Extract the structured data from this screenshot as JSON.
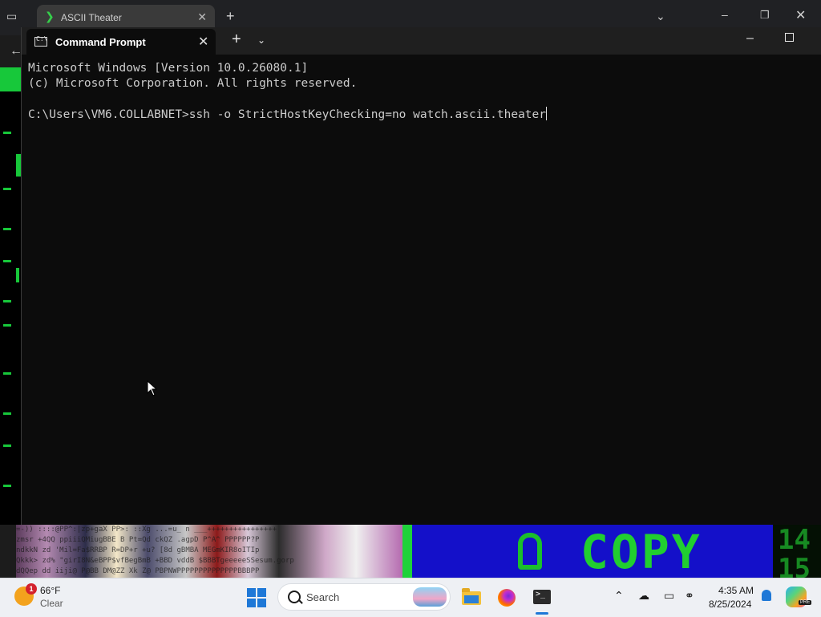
{
  "background_window": {
    "tab_title": "ASCII Theater",
    "ascii_rows": [
      "=-)) ::::@PP^:|zp+gaX  PP>:  ::Xg  ...=u_  n  ___++++++++++++++++",
      "zmsr +4QQ  ppiiiQMiugBBE    B  Pt=Qd    ckQZ  .agpD  P^A^  PPPPPP?P",
      "ndkkN zd   'Mil=Fa$RRBP   R=DP+r +u?  [8d  gBMBA  MEGmKIR8oITIp",
      "Qkkk> zd%   \"girI8N&eBPP$vfBegBmB +BBD  vddB  $BBBTgeeeeeSSesum.gorp",
      "dQQep dd     iiji@   P@BB  DM@ZZ  Xk  Z@  PBPNWPPPPPPPPPPPPPPBBBPP"
    ],
    "copy_banner_text": "COPY",
    "right_numbers": [
      "14",
      "15"
    ]
  },
  "terminal": {
    "tab_title": "Command Prompt",
    "lines": [
      "Microsoft Windows [Version 10.0.26080.1]",
      "(c) Microsoft Corporation. All rights reserved.",
      "",
      "C:\\Users\\VM6.COLLABNET>ssh -o StrictHostKeyChecking=no watch.ascii.theater"
    ]
  },
  "taskbar": {
    "weather_temp": "66°F",
    "weather_condition": "Clear",
    "weather_badge": "1",
    "search_placeholder": "Search",
    "clock_time": "4:35 AM",
    "clock_date": "8/25/2024",
    "copilot_badge": "PRE"
  },
  "colors": {
    "terminal_bg": "#0c0c0c",
    "terminal_text": "#cccccc",
    "copy_banner_bg": "#1410c9",
    "copy_banner_text": "#21cf30",
    "taskbar_bg": "#eef0f4",
    "accent": "#1e78d7"
  }
}
